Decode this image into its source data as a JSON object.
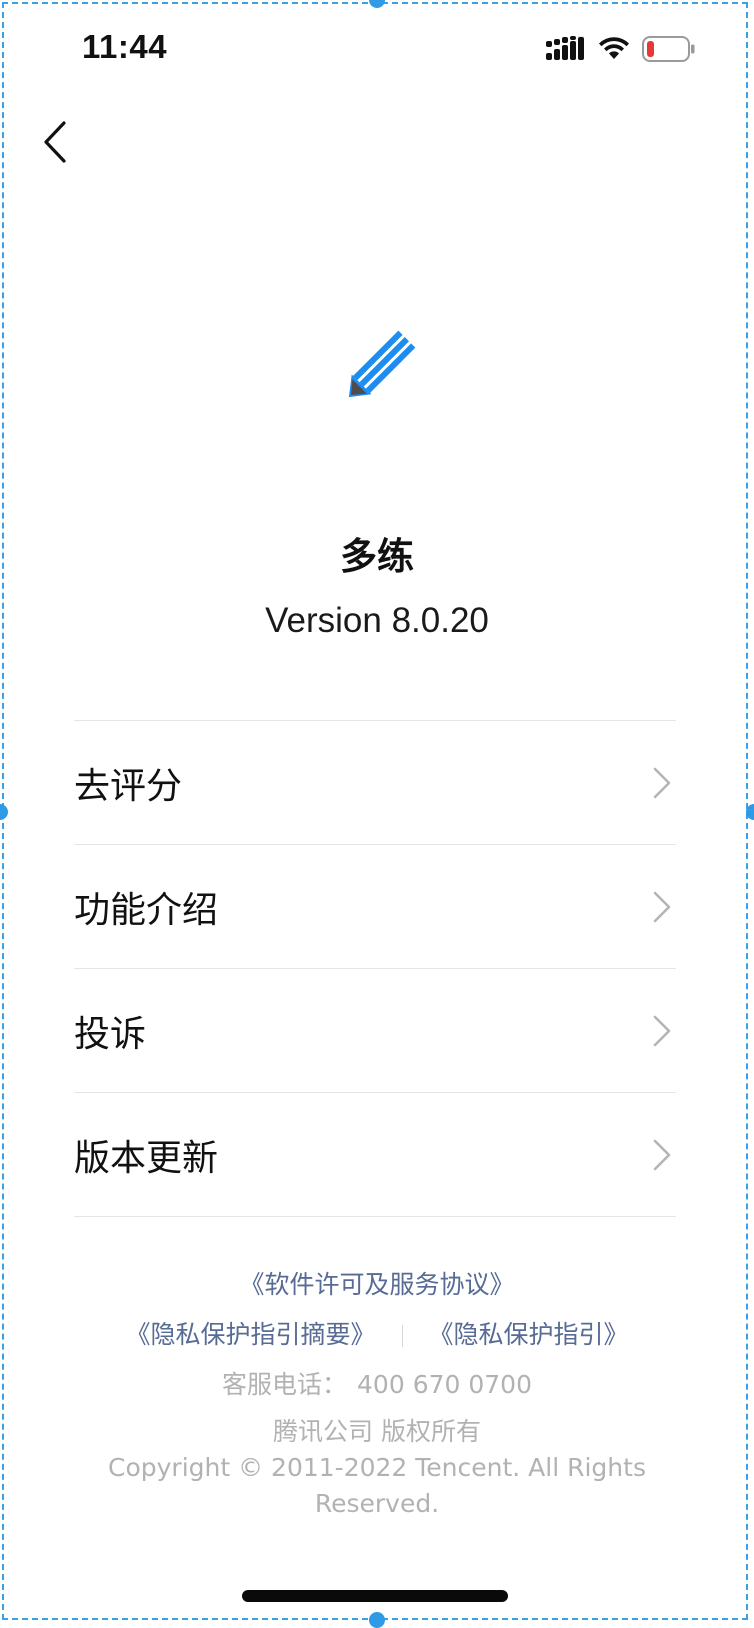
{
  "status_bar": {
    "time": "11:44",
    "icons": [
      "cellular-signal-icon",
      "wifi-icon",
      "battery-low-icon"
    ],
    "battery_color": "#e53935"
  },
  "nav": {
    "back_icon": "chevron-left-icon"
  },
  "app": {
    "name": "多练",
    "version": "Version 8.0.20",
    "logo_icon": "pencil-icon",
    "logo_color": "#1e8df0"
  },
  "menu": [
    {
      "label": "去评分"
    },
    {
      "label": "功能介绍"
    },
    {
      "label": "投诉"
    },
    {
      "label": "版本更新"
    }
  ],
  "links": {
    "license": "《软件许可及服务协议》",
    "privacy_summary": "《隐私保护指引摘要》",
    "privacy": "《隐私保护指引》",
    "link_color": "#576b95"
  },
  "support": {
    "hotline_label": "客服电话：",
    "hotline_number": "400 670 0700"
  },
  "footer": {
    "company": "腾讯公司 版权所有",
    "copyright": "Copyright © 2011-2022 Tencent. All Rights Reserved."
  }
}
